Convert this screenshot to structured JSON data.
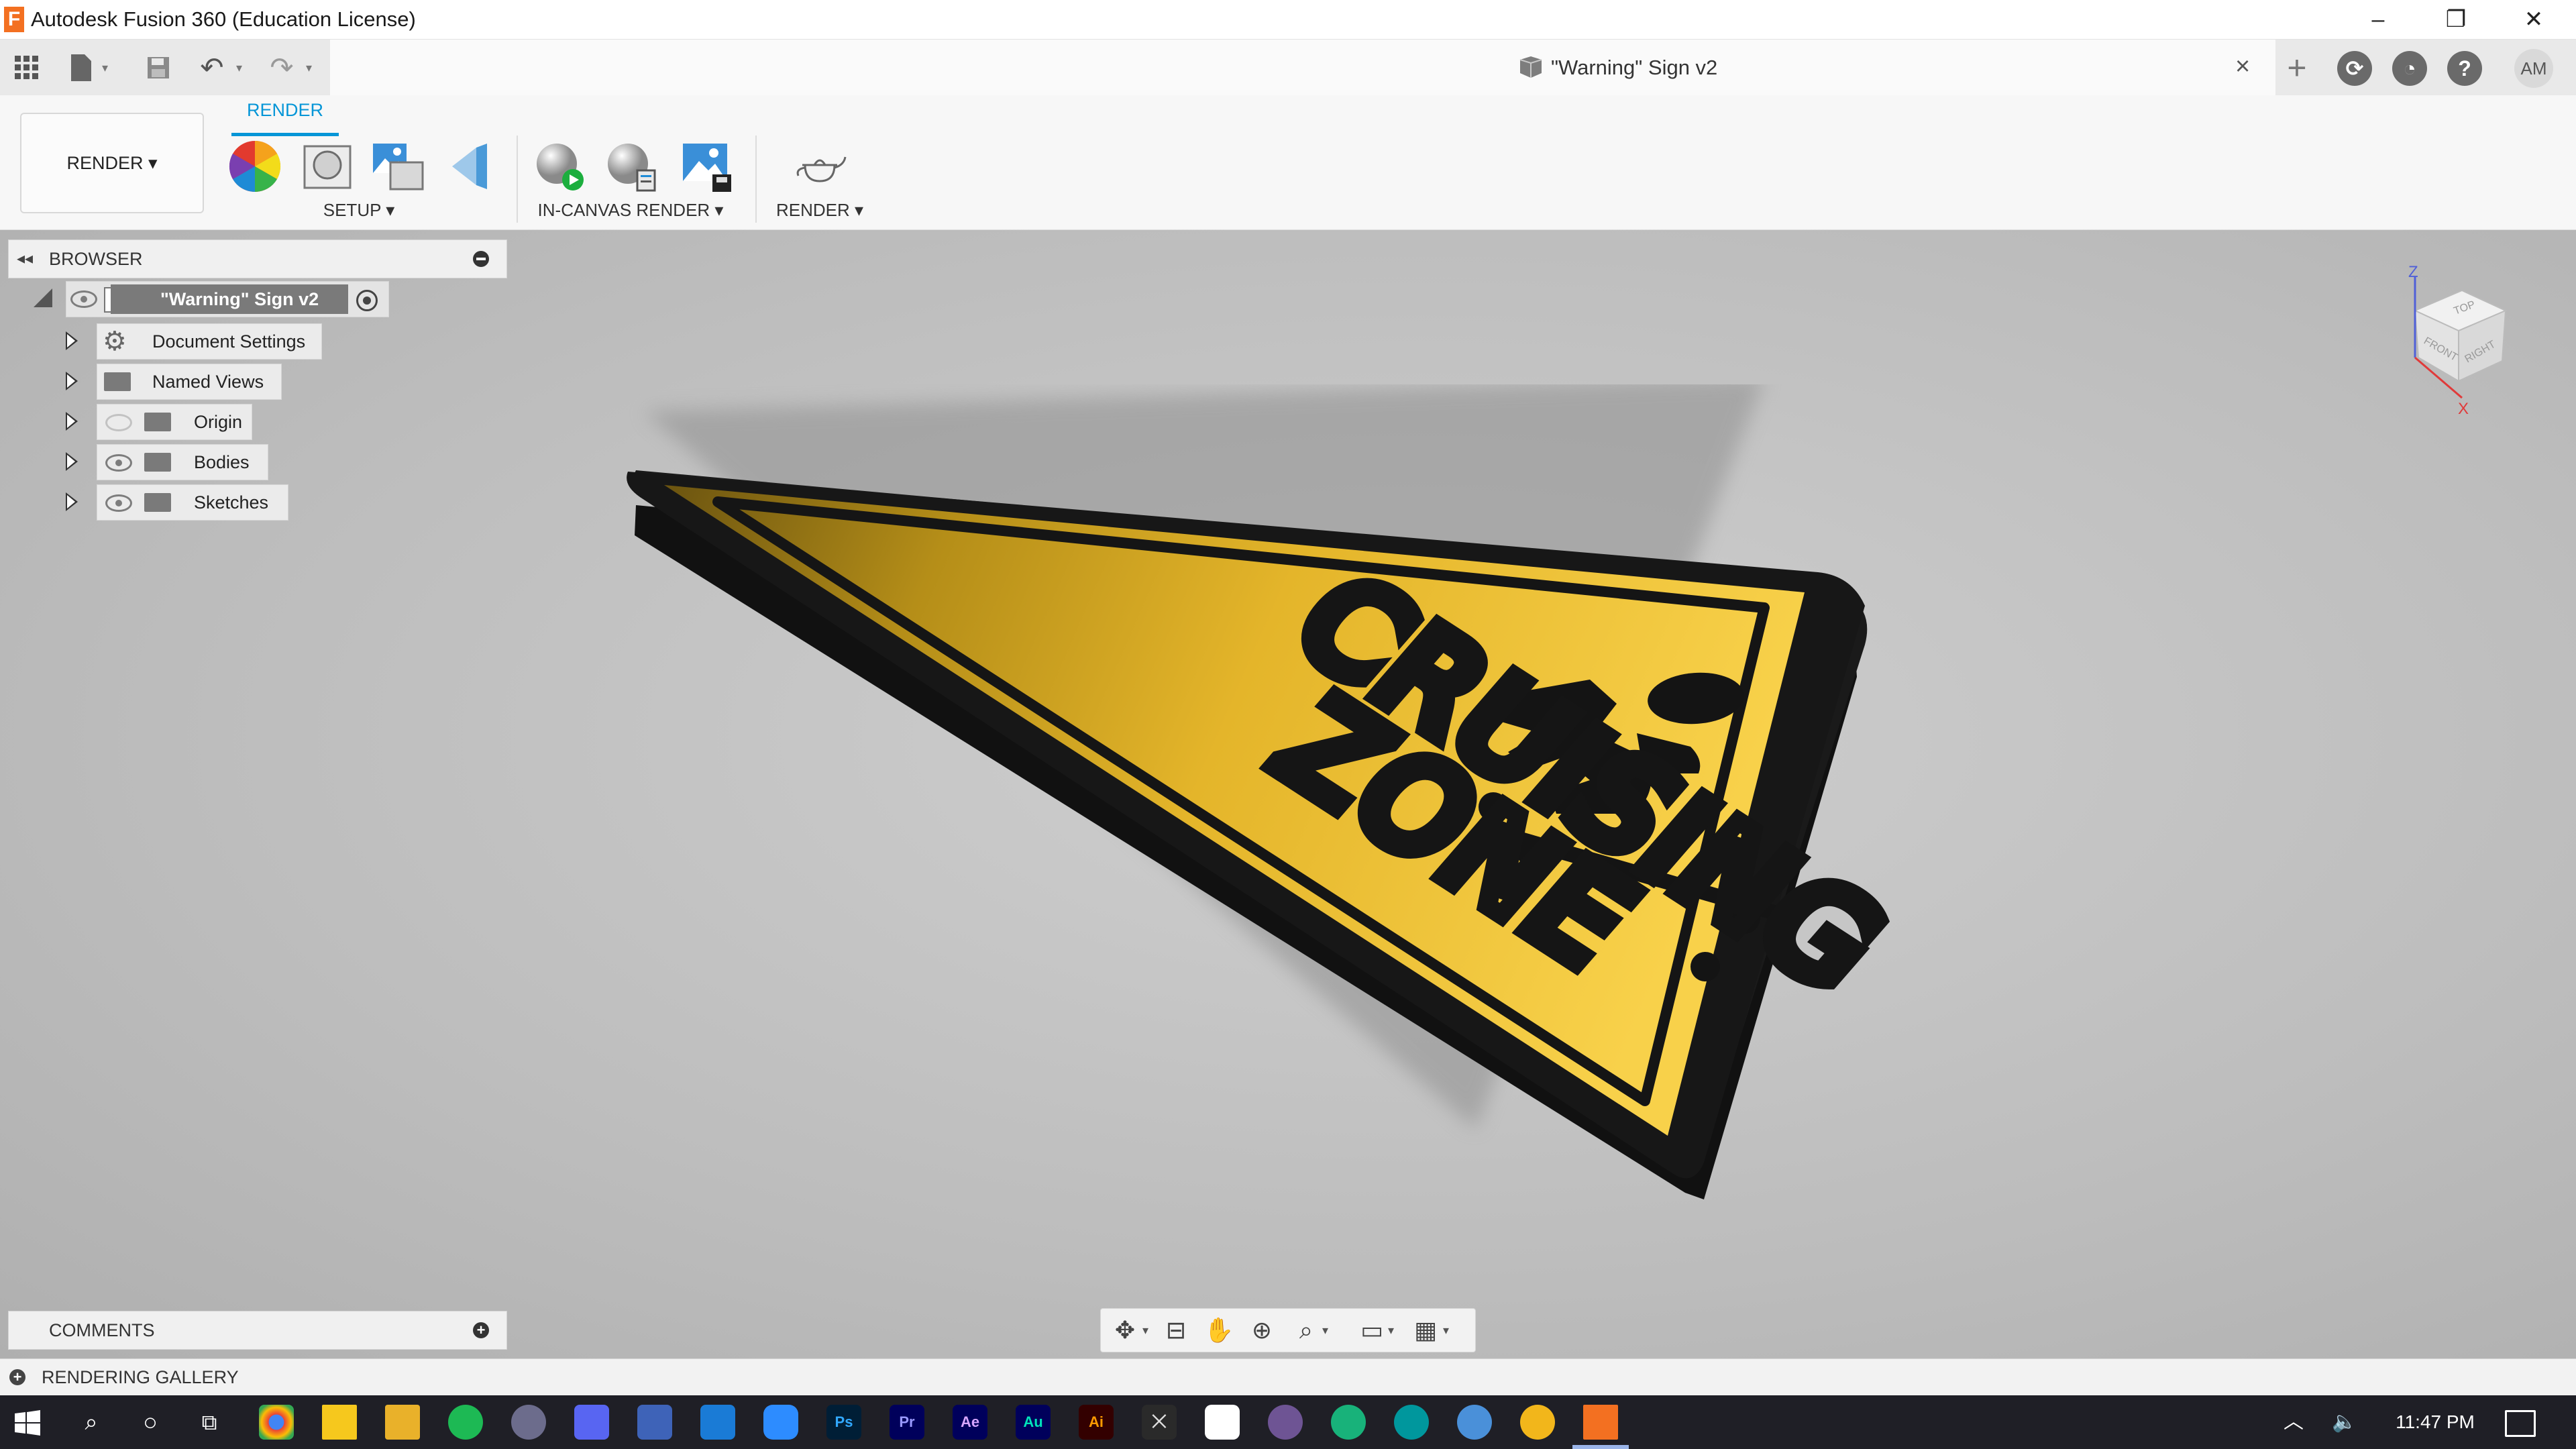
{
  "titlebar": {
    "app_logo": "F",
    "title": "Autodesk Fusion 360 (Education License)",
    "minimize": "–",
    "restore": "❐",
    "close": "✕"
  },
  "doc_tab": {
    "title": "\"Warning\" Sign v2",
    "close": "×"
  },
  "user": {
    "initials": "AM"
  },
  "ribbon": {
    "workspace_label": "RENDER ▾",
    "active_tab": "RENDER",
    "groups": {
      "setup": "SETUP ▾",
      "in_canvas_render": "IN-CANVAS RENDER ▾",
      "render": "RENDER ▾"
    }
  },
  "browser": {
    "label": "BROWSER",
    "root": "\"Warning\" Sign v2",
    "items": [
      {
        "label": "Document Settings",
        "icon": "gear-icon"
      },
      {
        "label": "Named Views",
        "icon": "folder-icon"
      },
      {
        "label": "Origin",
        "icon": "folder-icon",
        "visible": false
      },
      {
        "label": "Bodies",
        "icon": "folder-icon",
        "visible": true
      },
      {
        "label": "Sketches",
        "icon": "folder-icon",
        "visible": true
      }
    ]
  },
  "viewcube": {
    "top": "TOP",
    "front": "FRONT",
    "right": "RIGHT",
    "axis_z": "Z",
    "axis_x": "X"
  },
  "model": {
    "line1": "CRUISING",
    "line2": "ZONE",
    "colors": {
      "sign_yellow": "#f2c02a",
      "border_black": "#141414"
    }
  },
  "comments": {
    "label": "COMMENTS"
  },
  "gallery": {
    "label": "RENDERING GALLERY"
  },
  "taskbar": {
    "apps": [
      "Ps",
      "Pr",
      "Ae",
      "Au",
      "Ai"
    ],
    "time": "11:47 PM"
  },
  "colors": {
    "accent": "#0696d7",
    "taskbar": "#1f1f26"
  }
}
